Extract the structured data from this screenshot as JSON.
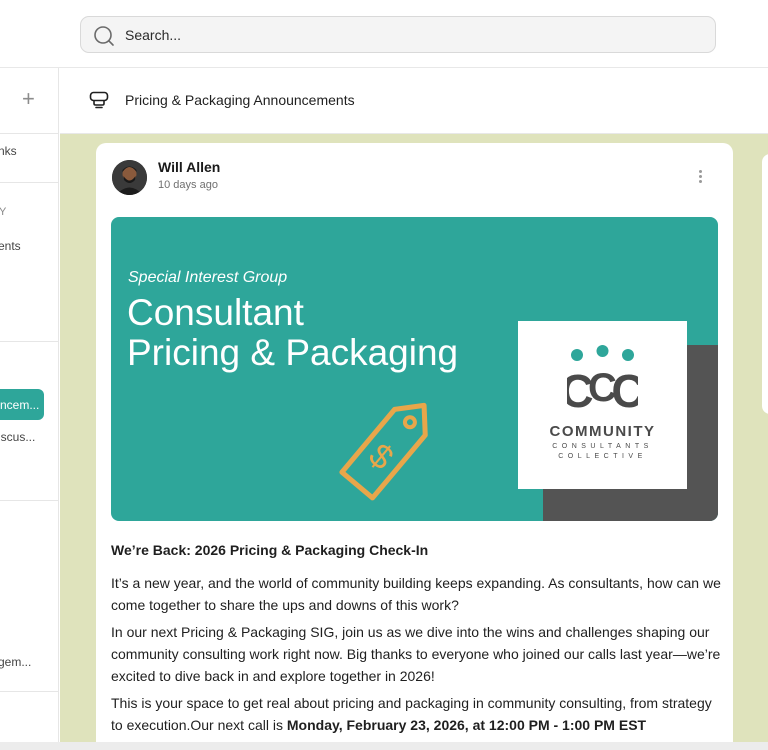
{
  "search": {
    "placeholder": "Search..."
  },
  "sidebar": {
    "add_symbol": "+",
    "items": [
      {
        "label": "nks"
      },
      {
        "label": "Y"
      },
      {
        "label": "ents"
      },
      {
        "label": "ncem...",
        "active": true
      },
      {
        "label": "iscus..."
      },
      {
        "label": "gem..."
      }
    ]
  },
  "channel": {
    "title": "Pricing & Packaging Announcements",
    "icon": "announcement-icon"
  },
  "post": {
    "author": "Will Allen",
    "time": "10 days ago",
    "banner": {
      "kicker": "Special Interest Group",
      "title_line1": "Consultant",
      "title_line2": "Pricing & Packaging",
      "logo_mark": "CCC",
      "logo_name": "COMMUNITY",
      "logo_sub1": "CONSULTANTS",
      "logo_sub2": "COLLECTIVE"
    },
    "heading": "We’re Back: 2026 Pricing & Packaging Check-In",
    "para1": "It’s a new year, and the world of community building keeps expanding. As consultants, how can we come together to share the ups and downs of this work?",
    "para2": "In our next Pricing & Packaging SIG, join us as we dive into the wins and challenges shaping our community consulting work right now. Big thanks to everyone who joined our calls last year—we’re excited to dive back in and explore together in 2026!",
    "para3_lead": "This is your space to get real about pricing and packaging in community consulting, from strategy to execution.Our next call is ",
    "para3_bold": "Monday, February 23, 2026, at 12:00 PM - 1:00 PM EST"
  },
  "colors": {
    "accent": "#2ea69a",
    "feed_bg": "#dfe3bc",
    "tag_orange": "#e8a64a",
    "logo_gray": "#545454"
  }
}
